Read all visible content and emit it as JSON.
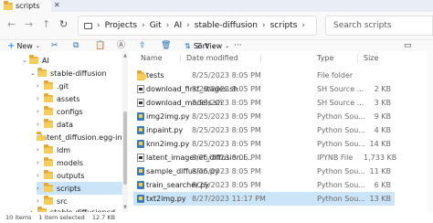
{
  "window": {
    "tab_title": "scripts"
  },
  "address_bar": {
    "breadcrumbs": [
      "Projects",
      "Git",
      "AI",
      "stable-diffusion",
      "scripts"
    ]
  },
  "search": {
    "placeholder": "Search scripts"
  },
  "command_bar": {
    "new_label": "New",
    "sort_label": "Sort",
    "view_label": "View"
  },
  "nav_pane": {
    "items": [
      {
        "label": "AI",
        "expanded": true,
        "indent": 0
      },
      {
        "label": "stable-diffusion",
        "expanded": true,
        "indent": 1
      },
      {
        "label": ".git",
        "expanded": false,
        "indent": 2
      },
      {
        "label": "assets",
        "expanded": false,
        "indent": 2
      },
      {
        "label": "configs",
        "expanded": false,
        "indent": 2
      },
      {
        "label": "data",
        "expanded": false,
        "indent": 2
      },
      {
        "label": "latent_diffusion.egg-info",
        "expanded": false,
        "indent": 2
      },
      {
        "label": "ldm",
        "expanded": false,
        "indent": 2
      },
      {
        "label": "models",
        "expanded": false,
        "indent": 2
      },
      {
        "label": "outputs",
        "expanded": false,
        "indent": 2
      },
      {
        "label": "scripts",
        "expanded": false,
        "indent": 2,
        "selected": true
      },
      {
        "label": "src",
        "expanded": false,
        "indent": 2
      },
      {
        "label": "stable-diffusioncd",
        "expanded": false,
        "indent": 1
      }
    ]
  },
  "file_list": {
    "columns": [
      "Name",
      "Date modified",
      "Type",
      "Size"
    ],
    "rows": [
      {
        "name": "tests",
        "icon": "folder-icon",
        "date": "8/25/2023 8:05 PM",
        "type": "File folder",
        "size": ""
      },
      {
        "name": "download_first_stages.sh",
        "icon": "shell-script-icon",
        "date": "8/25/2023 8:05 PM",
        "type": "SH Source ...",
        "size": "2 KB"
      },
      {
        "name": "download_models.sh",
        "icon": "shell-script-icon",
        "date": "8/25/2023 8:05 PM",
        "type": "SH Source ...",
        "size": "3 KB"
      },
      {
        "name": "img2img.py",
        "icon": "python-file-icon",
        "date": "8/25/2023 8:05 PM",
        "type": "Python Sou...",
        "size": "9 KB"
      },
      {
        "name": "inpaint.py",
        "icon": "python-file-icon",
        "date": "8/25/2023 8:05 PM",
        "type": "Python Sou...",
        "size": "4 KB"
      },
      {
        "name": "knn2img.py",
        "icon": "python-file-icon",
        "date": "8/25/2023 8:05 PM",
        "type": "Python Sou...",
        "size": "14 KB"
      },
      {
        "name": "latent_imagenet_diffusion.i...",
        "icon": "notebook-file-icon",
        "date": "8/25/2023 8:05 PM",
        "type": "IPYNB File",
        "size": "1,733 KB"
      },
      {
        "name": "sample_diffusion.py",
        "icon": "python-file-icon",
        "date": "8/25/2023 8:05 PM",
        "type": "Python Sou...",
        "size": "11 KB"
      },
      {
        "name": "train_searcher.py",
        "icon": "python-file-icon",
        "date": "8/25/2023 8:05 PM",
        "type": "Python Sou...",
        "size": "6 KB"
      },
      {
        "name": "txt2img.py",
        "icon": "python-file-icon",
        "date": "8/27/2023 11:17 PM",
        "type": "Python Sou...",
        "size": "13 KB",
        "selected": true
      }
    ]
  },
  "status_bar": {
    "item_count": "10 items",
    "selection": "1 item selected",
    "selection_size": "12.7 KB"
  }
}
